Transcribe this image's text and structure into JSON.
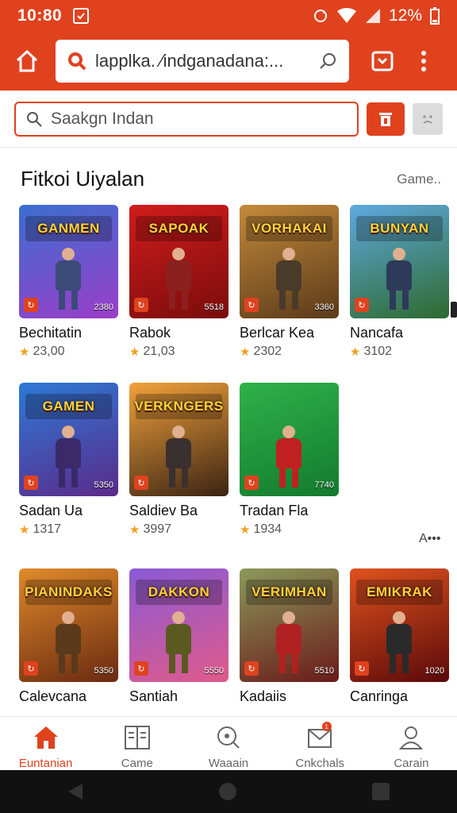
{
  "status": {
    "time": "10:80",
    "battery": "12%"
  },
  "browser": {
    "url": "lapplka. ⁄indganadana:..."
  },
  "search": {
    "placeholder": "Saakgn Indan"
  },
  "section": {
    "title": "Fitkoi Uiyalan",
    "more": "Game..",
    "side_more": "A•••"
  },
  "colors": {
    "accent": "#e0421e",
    "star": "#f0a020"
  },
  "games": [
    {
      "name": "Bechitatin",
      "rating": "23,00",
      "banner": "GANMEN",
      "count": "2380",
      "bg": [
        "#3b6fd0",
        "#9b3dc9"
      ],
      "hero": "#3c4a7a"
    },
    {
      "name": "Rabok",
      "rating": "21,03",
      "banner": "SAPOAK",
      "count": "5518",
      "bg": [
        "#d21c1c",
        "#7a0c0c"
      ],
      "hero": "#8c1f1f"
    },
    {
      "name": "Berlcar Kea",
      "rating": "2302",
      "banner": "VORHAKAI",
      "count": "3360",
      "bg": [
        "#c48a3a",
        "#5a3a1a"
      ],
      "hero": "#4a3a2a"
    },
    {
      "name": "Nancafa",
      "rating": "3102",
      "banner": "BUNYAN",
      "count": "",
      "bg": [
        "#5fa9e0",
        "#2e6a2e"
      ],
      "hero": "#2d3a5a"
    },
    {
      "name": "Sadan Ua",
      "rating": "1317",
      "banner": "GAMEN",
      "count": "5350",
      "bg": [
        "#2d7ad6",
        "#5b2a8a"
      ],
      "hero": "#3a2a6a"
    },
    {
      "name": "Saldiev Ba",
      "rating": "3997",
      "banner": "VERKNGERS",
      "count": "",
      "bg": [
        "#f2a13a",
        "#3a2414"
      ],
      "hero": "#3a3030"
    },
    {
      "name": "Tradan Fla",
      "rating": "1934",
      "banner": "",
      "count": "7740",
      "bg": [
        "#2fb24a",
        "#137a2e"
      ],
      "hero": "#c02020"
    },
    {
      "name": "Calevcana",
      "rating": "",
      "banner": "PIANINDAKS",
      "count": "5350",
      "bg": [
        "#e08a2a",
        "#6a2a10"
      ],
      "hero": "#5a3a1a"
    },
    {
      "name": "Santiah",
      "rating": "",
      "banner": "DAKKON",
      "count": "5550",
      "bg": [
        "#8a5ad6",
        "#e05a8a"
      ],
      "hero": "#5a5a20"
    },
    {
      "name": "Kadaiis",
      "rating": "",
      "banner": "VERIMHAN",
      "count": "5510",
      "bg": [
        "#8a9a5a",
        "#6a1a1a"
      ],
      "hero": "#b02020"
    },
    {
      "name": "Canringa",
      "rating": "",
      "banner": "EMIKRAK",
      "count": "1020",
      "bg": [
        "#e0521e",
        "#5a0a0a"
      ],
      "hero": "#2a2a2a"
    }
  ],
  "nav": [
    {
      "label": "Euntanian",
      "icon": "home-icon",
      "active": true
    },
    {
      "label": "Came",
      "icon": "grid-icon",
      "active": false
    },
    {
      "label": "Waaain",
      "icon": "search-icon",
      "active": false
    },
    {
      "label": "Cnkchals",
      "icon": "mail-icon",
      "active": false,
      "badge": "1"
    },
    {
      "label": "Carain",
      "icon": "user-icon",
      "active": false
    }
  ]
}
